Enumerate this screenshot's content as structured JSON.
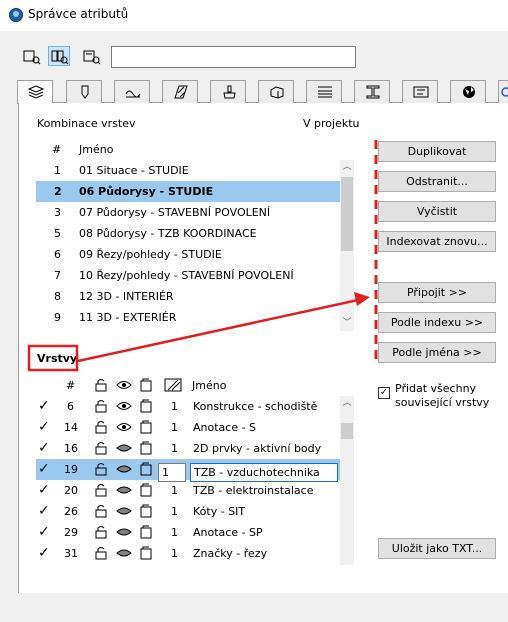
{
  "window": {
    "title": "Správce atributů"
  },
  "search": {
    "value": ""
  },
  "combinations": {
    "header": "Kombinace vrstev",
    "in_project": "V projektu",
    "col_name": "Jméno",
    "col_num": "#",
    "rows": [
      {
        "num": "1",
        "name": "01 Situace - STUDIE",
        "selected": false
      },
      {
        "num": "2",
        "name": "06 Půdorysy - STUDIE",
        "selected": true
      },
      {
        "num": "3",
        "name": "07 Půdorysy - STAVEBNÍ POVOLENÍ",
        "selected": false
      },
      {
        "num": "5",
        "name": "08 Půdorysy - TZB KOORDINACE",
        "selected": false
      },
      {
        "num": "6",
        "name": "09 Řezy/pohledy - STUDIE",
        "selected": false
      },
      {
        "num": "7",
        "name": "10 Řezy/pohledy - STAVEBNÍ POVOLENÍ",
        "selected": false
      },
      {
        "num": "8",
        "name": "12 3D - INTERIÉR",
        "selected": false
      },
      {
        "num": "9",
        "name": "11 3D - EXTERIÉR",
        "selected": false
      }
    ]
  },
  "buttons": {
    "duplicate": "Duplikovat",
    "remove": "Odstranit...",
    "clean": "Vyčistit",
    "reindex": "Indexovat znovu...",
    "attach": "Připojit >>",
    "by_index": "Podle indexu >>",
    "by_name": "Podle jména >>",
    "save_txt": "Uložit jako TXT..."
  },
  "layers": {
    "header": "Vrstvy",
    "col_num": "#",
    "col_name": "Jméno",
    "add_all_label_1": "Přidat všechny",
    "add_all_label_2": "související vrstvy",
    "add_all_checked": true,
    "rows": [
      {
        "num": "6",
        "pen": "1",
        "name": "Konstrukce - schodiště",
        "checked": true,
        "selected": false,
        "hidden": false
      },
      {
        "num": "14",
        "pen": "1",
        "name": "Anotace - S",
        "checked": true,
        "selected": false,
        "hidden": false
      },
      {
        "num": "16",
        "pen": "1",
        "name": "2D prvky - aktivní body",
        "checked": true,
        "selected": false,
        "hidden": true
      },
      {
        "num": "19",
        "pen": "1",
        "name": "TZB - vzduchotechnika",
        "checked": true,
        "selected": true,
        "hidden": true
      },
      {
        "num": "20",
        "pen": "1",
        "name": "TZB - elektroinstalace",
        "checked": true,
        "selected": false,
        "hidden": true
      },
      {
        "num": "26",
        "pen": "1",
        "name": "Kóty - SIT",
        "checked": true,
        "selected": false,
        "hidden": true
      },
      {
        "num": "29",
        "pen": "1",
        "name": "Anotace - SP",
        "checked": true,
        "selected": false,
        "hidden": true
      },
      {
        "num": "31",
        "pen": "1",
        "name": "Značky - řezy",
        "checked": true,
        "selected": false,
        "hidden": true
      }
    ]
  },
  "colors": {
    "accent": "#1f5fa8",
    "selection": "#99c9ef",
    "annotation": "#e02020"
  }
}
